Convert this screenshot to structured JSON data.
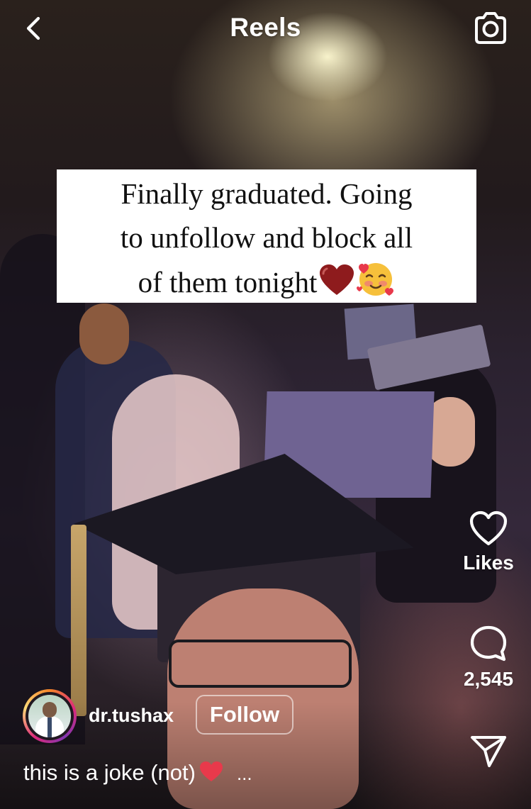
{
  "header": {
    "title": "Reels",
    "back_icon": "chevron-left-icon",
    "camera_icon": "camera-icon"
  },
  "reel": {
    "overlay_text_lines": [
      "Finally graduated. Going",
      "to unfollow and block all",
      "of them tonight"
    ],
    "overlay_emojis": [
      "heart-icon",
      "smiling-face-with-hearts-icon"
    ]
  },
  "actions": {
    "like_label": "Likes",
    "comment_count": "2,545",
    "like_icon": "heart-outline-icon",
    "comment_icon": "comment-bubble-icon",
    "share_icon": "paper-plane-icon"
  },
  "author": {
    "username": "dr.tushax",
    "follow_label": "Follow"
  },
  "caption": {
    "text": "this is a joke (not)",
    "more": "..."
  },
  "colors": {
    "heart_red": "#e8394b",
    "dark_heart": "#8e1b1d"
  }
}
